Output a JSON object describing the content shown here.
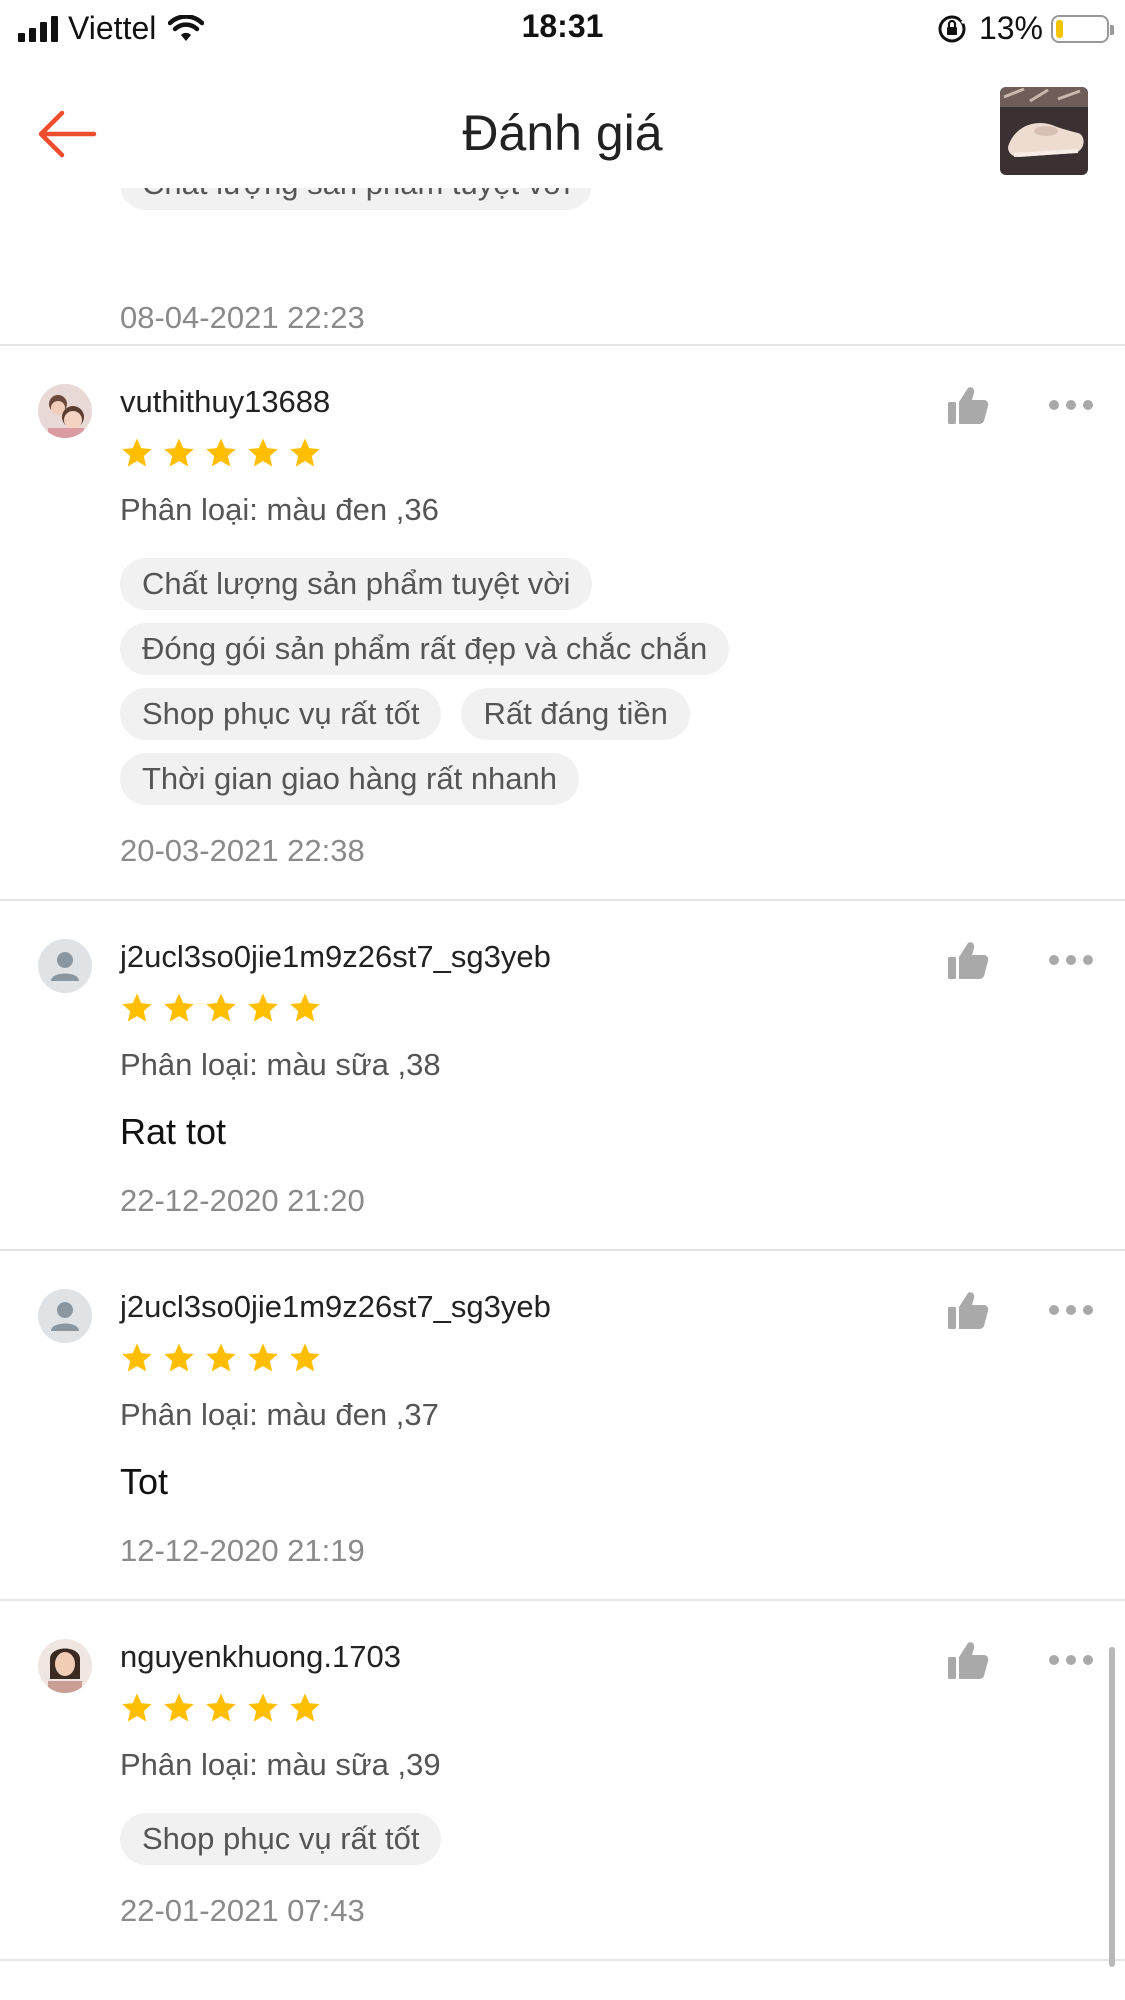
{
  "status_bar": {
    "carrier": "Viettel",
    "time": "18:31",
    "battery_percent": "13%",
    "battery_level": 0.13
  },
  "header": {
    "title": "Đánh giá",
    "back_icon": "arrow-left-icon",
    "accent_color": "#ee4d2d"
  },
  "star_color": "#ffbf00",
  "partial_review": {
    "tag": "Chất lượng sản phẩm tuyệt vời",
    "date": "08-04-2021 22:23"
  },
  "reviews": [
    {
      "username": "vuthithuy13688",
      "rating": 5,
      "variant": "Phân loại: màu đen ,36",
      "tags": [
        "Chất lượng sản phẩm tuyệt vời",
        "Đóng gói sản phẩm rất đẹp và chắc chắn",
        "Shop phục vụ rất tốt",
        "Rất đáng tiền",
        "Thời gian giao hàng rất nhanh"
      ],
      "comment": "",
      "date": "20-03-2021 22:38"
    },
    {
      "username": "j2ucl3so0jie1m9z26st7_sg3yeb",
      "rating": 5,
      "variant": "Phân loại: màu sữa ,38",
      "tags": [],
      "comment": "Rat tot",
      "date": "22-12-2020 21:20"
    },
    {
      "username": "j2ucl3so0jie1m9z26st7_sg3yeb",
      "rating": 5,
      "variant": "Phân loại: màu đen ,37",
      "tags": [],
      "comment": "Tot",
      "date": "12-12-2020 21:19"
    },
    {
      "username": "nguyenkhuong.1703",
      "rating": 5,
      "variant": "Phân loại: màu sữa ,39",
      "tags": [
        "Shop phục vụ rất tốt"
      ],
      "comment": "",
      "date": "22-01-2021 07:43"
    }
  ]
}
